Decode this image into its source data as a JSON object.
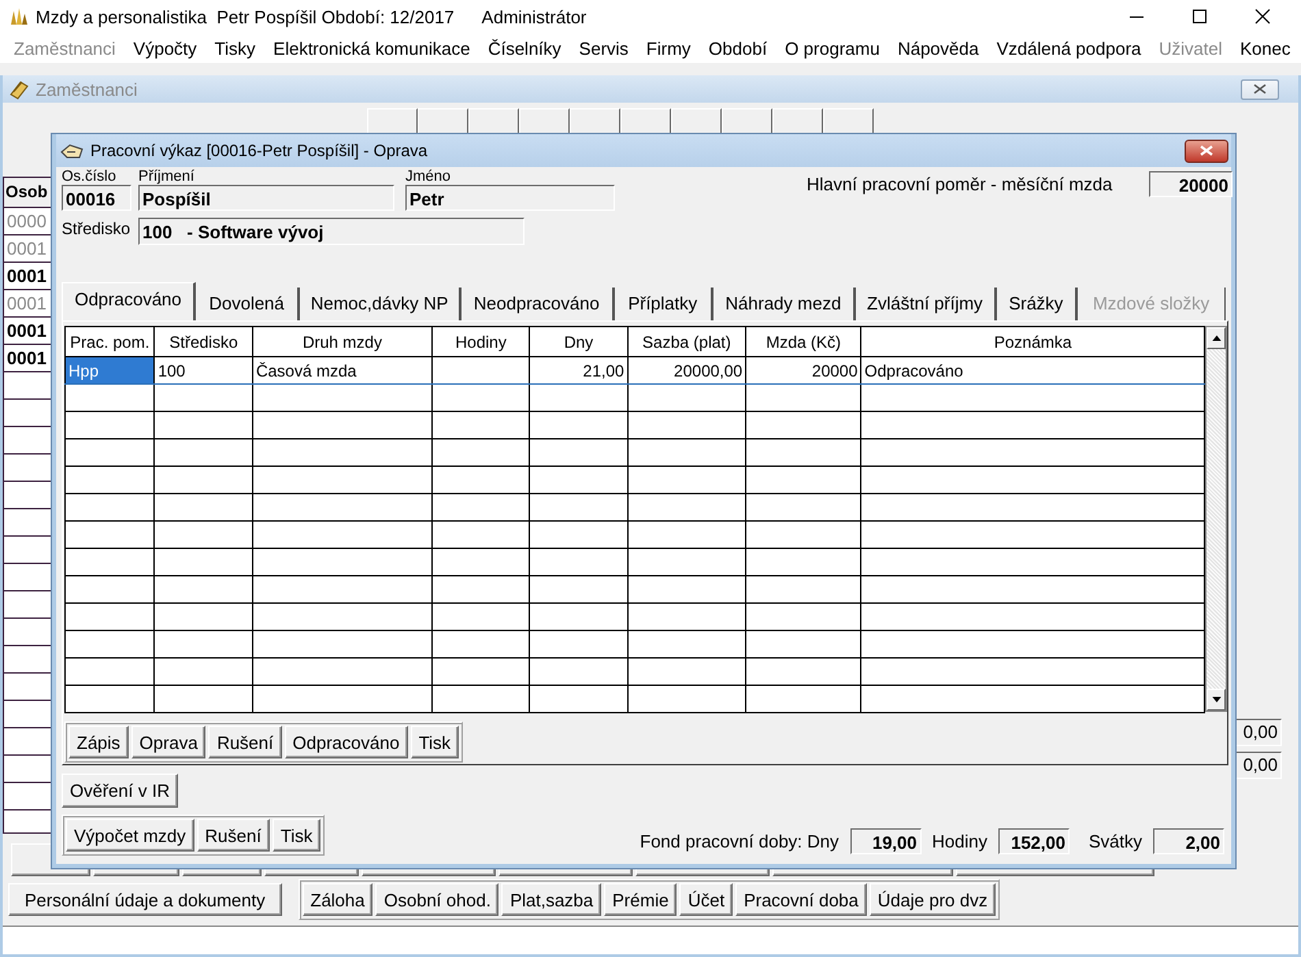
{
  "app_window": {
    "title": "Mzdy a personalistika  Petr Pospíšil Období: 12/2017",
    "user": "Administrátor"
  },
  "menu": [
    {
      "label": "Zaměstnanci",
      "disabled": true
    },
    {
      "label": "Výpočty",
      "disabled": false
    },
    {
      "label": "Tisky",
      "disabled": false
    },
    {
      "label": "Elektronická komunikace",
      "disabled": false
    },
    {
      "label": "Číselníky",
      "disabled": false
    },
    {
      "label": "Servis",
      "disabled": false
    },
    {
      "label": "Firmy",
      "disabled": false
    },
    {
      "label": "Období",
      "disabled": false
    },
    {
      "label": "O programu",
      "disabled": false
    },
    {
      "label": "Nápověda",
      "disabled": false
    },
    {
      "label": "Vzdálená podpora",
      "disabled": false
    },
    {
      "label": "Uživatel",
      "disabled": true
    },
    {
      "label": "Konec",
      "disabled": false
    }
  ],
  "employees_window": {
    "title": "Zaměstnanci",
    "list": {
      "header": "Osob",
      "rows": [
        {
          "text": "0000",
          "active": false
        },
        {
          "text": "0001",
          "active": false
        },
        {
          "text": "0001",
          "active": true
        },
        {
          "text": "0001",
          "active": false
        },
        {
          "text": "0001",
          "active": true
        },
        {
          "text": "0001",
          "active": true
        }
      ]
    },
    "side_values": [
      "0,00",
      "0,00"
    ],
    "personal_button": "Personální údaje a dokumenty",
    "record_buttons": [
      "Záloha",
      "Osobní ohod.",
      "Plat,sazba",
      "Prémie",
      "Účet",
      "Pracovní doba",
      "Údaje pro dvz"
    ]
  },
  "dialog": {
    "title": "Pracovní výkaz [00016-Petr Pospíšil] - Oprava",
    "fields": [
      {
        "label": "Os.číslo",
        "value": "00016"
      },
      {
        "label": "Příjmení",
        "value": "Pospíšil"
      },
      {
        "label": "Jméno",
        "value": "Petr"
      }
    ],
    "center": {
      "label": "Středisko",
      "value": "100   - Software vývoj"
    },
    "main_contract": {
      "label": "Hlavní pracovní poměr - měsíční mzda",
      "value": "20000"
    },
    "tabs": [
      {
        "label": "Odpracováno",
        "selected": true,
        "disabled": false
      },
      {
        "label": "Dovolená",
        "selected": false,
        "disabled": false
      },
      {
        "label": "Nemoc,dávky NP",
        "selected": false,
        "disabled": false
      },
      {
        "label": "Neodpracováno",
        "selected": false,
        "disabled": false
      },
      {
        "label": "Příplatky",
        "selected": false,
        "disabled": false
      },
      {
        "label": "Náhrady mezd",
        "selected": false,
        "disabled": false
      },
      {
        "label": "Zvláštní příjmy",
        "selected": false,
        "disabled": false
      },
      {
        "label": "Srážky",
        "selected": false,
        "disabled": false
      },
      {
        "label": "Mzdové složky",
        "selected": false,
        "disabled": true
      }
    ],
    "table": {
      "columns": [
        "Prac. pom.",
        "Středisko",
        "Druh mzdy",
        "Hodiny",
        "Dny",
        "Sazba (plat)",
        "Mzda (Kč)",
        "Poznámka"
      ],
      "rows": [
        {
          "selected": true,
          "cells": [
            "Hpp",
            "100",
            "Časová mzda",
            "",
            "21,00",
            "20000,00",
            "20000",
            "Odpracováno"
          ]
        }
      ]
    },
    "grid_buttons": [
      "Zápis",
      "Oprava",
      "Rušení",
      "Odpracováno",
      "Tisk"
    ],
    "verify_button": "Ověření v IR",
    "calc_buttons": [
      "Výpočet mzdy",
      "Rušení",
      "Tisk"
    ],
    "fund": {
      "label": "Fond pracovní doby: Dny",
      "days": "19,00",
      "hours_label": "Hodiny",
      "hours": "152,00",
      "holidays_label": "Svátky",
      "holidays": "2,00"
    }
  }
}
